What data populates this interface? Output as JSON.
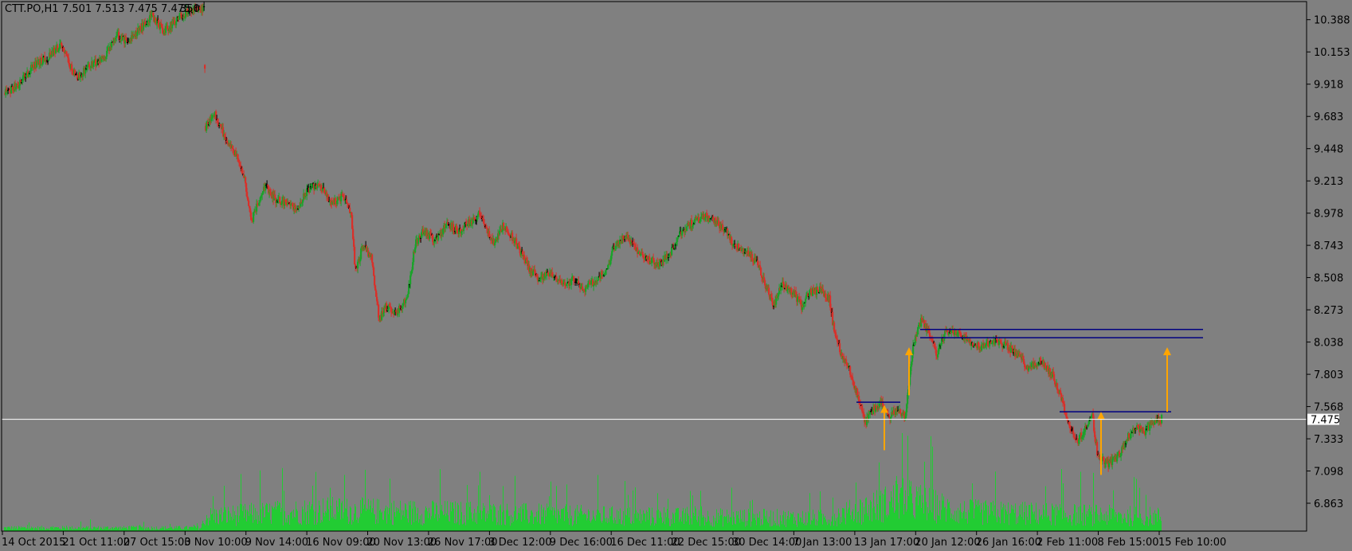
{
  "header": {
    "symbol": "CTT.PO,H1",
    "ohlc": "7.501 7.513 7.475 7.475",
    "volume": "350"
  },
  "colors": {
    "background": "#808080",
    "bull": "#1aa32a",
    "bear": "#d8302a",
    "doji": "#000000",
    "volume": "#22cc33",
    "level_line": "#000080",
    "arrow": "#ffa500",
    "bid_line": "#ffffff"
  },
  "chart_data": {
    "type": "candlestick",
    "ylim": [
      6.66,
      10.52
    ],
    "y_ticks": [
      "10.388",
      "10.153",
      "9.918",
      "9.683",
      "9.448",
      "9.213",
      "8.978",
      "8.743",
      "8.508",
      "8.273",
      "8.038",
      "7.803",
      "7.568",
      "7.333",
      "7.098",
      "6.863"
    ],
    "x_ticks": [
      "14 Oct 2015",
      "21 Oct 11:00",
      "27 Oct 15:00",
      "3 Nov 10:00",
      "9 Nov 14:00",
      "16 Nov 09:00",
      "20 Nov 13:00",
      "26 Nov 17:00",
      "3 Dec 12:00",
      "9 Dec 16:00",
      "16 Dec 11:00",
      "22 Dec 15:00",
      "30 Dec 14:00",
      "7 Jan 13:00",
      "13 Jan 17:00",
      "20 Jan 12:00",
      "26 Jan 16:00",
      "2 Feb 11:00",
      "8 Feb 15:00",
      "15 Feb 10:00"
    ],
    "current_price": "7.475",
    "path": [
      [
        0,
        9.85
      ],
      [
        20,
        9.93
      ],
      [
        35,
        10.05
      ],
      [
        55,
        10.12
      ],
      [
        70,
        10.2
      ],
      [
        90,
        9.96
      ],
      [
        110,
        10.07
      ],
      [
        125,
        10.1
      ],
      [
        140,
        10.28
      ],
      [
        155,
        10.22
      ],
      [
        170,
        10.32
      ],
      [
        185,
        10.42
      ],
      [
        200,
        10.3
      ],
      [
        215,
        10.38
      ],
      [
        230,
        10.45
      ],
      [
        250,
        10.48
      ],
      [
        252,
        9.6
      ],
      [
        262,
        9.72
      ],
      [
        275,
        9.55
      ],
      [
        290,
        9.4
      ],
      [
        300,
        9.25
      ],
      [
        310,
        8.92
      ],
      [
        325,
        9.18
      ],
      [
        340,
        9.08
      ],
      [
        355,
        9.05
      ],
      [
        365,
        9.0
      ],
      [
        380,
        9.15
      ],
      [
        395,
        9.2
      ],
      [
        410,
        9.05
      ],
      [
        425,
        9.1
      ],
      [
        435,
        8.95
      ],
      [
        440,
        8.55
      ],
      [
        450,
        8.75
      ],
      [
        460,
        8.65
      ],
      [
        470,
        8.2
      ],
      [
        478,
        8.3
      ],
      [
        490,
        8.25
      ],
      [
        505,
        8.35
      ],
      [
        515,
        8.75
      ],
      [
        525,
        8.85
      ],
      [
        540,
        8.78
      ],
      [
        555,
        8.9
      ],
      [
        570,
        8.85
      ],
      [
        585,
        8.92
      ],
      [
        595,
        8.97
      ],
      [
        605,
        8.85
      ],
      [
        615,
        8.75
      ],
      [
        625,
        8.88
      ],
      [
        640,
        8.78
      ],
      [
        655,
        8.6
      ],
      [
        670,
        8.5
      ],
      [
        685,
        8.55
      ],
      [
        700,
        8.45
      ],
      [
        715,
        8.5
      ],
      [
        725,
        8.42
      ],
      [
        740,
        8.48
      ],
      [
        755,
        8.55
      ],
      [
        765,
        8.75
      ],
      [
        780,
        8.8
      ],
      [
        795,
        8.7
      ],
      [
        805,
        8.65
      ],
      [
        820,
        8.6
      ],
      [
        835,
        8.68
      ],
      [
        850,
        8.85
      ],
      [
        865,
        8.92
      ],
      [
        880,
        8.95
      ],
      [
        895,
        8.9
      ],
      [
        905,
        8.85
      ],
      [
        915,
        8.75
      ],
      [
        930,
        8.7
      ],
      [
        945,
        8.6
      ],
      [
        955,
        8.45
      ],
      [
        965,
        8.3
      ],
      [
        975,
        8.45
      ],
      [
        990,
        8.4
      ],
      [
        1000,
        8.3
      ],
      [
        1010,
        8.4
      ],
      [
        1025,
        8.42
      ],
      [
        1035,
        8.35
      ],
      [
        1040,
        8.15
      ],
      [
        1050,
        7.95
      ],
      [
        1060,
        7.85
      ],
      [
        1070,
        7.65
      ],
      [
        1080,
        7.45
      ],
      [
        1090,
        7.55
      ],
      [
        1100,
        7.6
      ],
      [
        1110,
        7.48
      ],
      [
        1120,
        7.55
      ],
      [
        1130,
        7.5
      ],
      [
        1140,
        8.0
      ],
      [
        1150,
        8.2
      ],
      [
        1160,
        8.1
      ],
      [
        1170,
        7.95
      ],
      [
        1180,
        8.1
      ],
      [
        1195,
        8.12
      ],
      [
        1210,
        8.05
      ],
      [
        1225,
        8.0
      ],
      [
        1240,
        8.05
      ],
      [
        1255,
        8.02
      ],
      [
        1270,
        7.95
      ],
      [
        1285,
        7.85
      ],
      [
        1300,
        7.9
      ],
      [
        1315,
        7.8
      ],
      [
        1325,
        7.65
      ],
      [
        1335,
        7.45
      ],
      [
        1345,
        7.3
      ],
      [
        1355,
        7.4
      ],
      [
        1365,
        7.5
      ],
      [
        1372,
        7.2
      ],
      [
        1385,
        7.15
      ],
      [
        1400,
        7.22
      ],
      [
        1410,
        7.35
      ],
      [
        1420,
        7.42
      ],
      [
        1430,
        7.38
      ],
      [
        1440,
        7.45
      ],
      [
        1452,
        7.48
      ]
    ],
    "volume_path": [
      [
        0,
        4
      ],
      [
        250,
        4
      ],
      [
        252,
        18
      ],
      [
        400,
        26
      ],
      [
        600,
        22
      ],
      [
        800,
        18
      ],
      [
        1030,
        16
      ],
      [
        1130,
        40
      ],
      [
        1200,
        24
      ],
      [
        1452,
        18
      ]
    ],
    "levels": [
      {
        "price": 7.6,
        "x1": 1070,
        "x2": 1125
      },
      {
        "price": 8.13,
        "x1": 1150,
        "x2": 1505
      },
      {
        "price": 8.07,
        "x1": 1150,
        "x2": 1505
      },
      {
        "price": 7.53,
        "x1": 1325,
        "x2": 1465
      }
    ],
    "arrows": [
      {
        "x": 1105,
        "from": 7.25,
        "to": 7.58
      },
      {
        "x": 1136,
        "from": 7.65,
        "to": 8.0
      },
      {
        "x": 1377,
        "from": 7.07,
        "to": 7.53
      },
      {
        "x": 1460,
        "from": 7.53,
        "to": 8.0
      }
    ]
  }
}
